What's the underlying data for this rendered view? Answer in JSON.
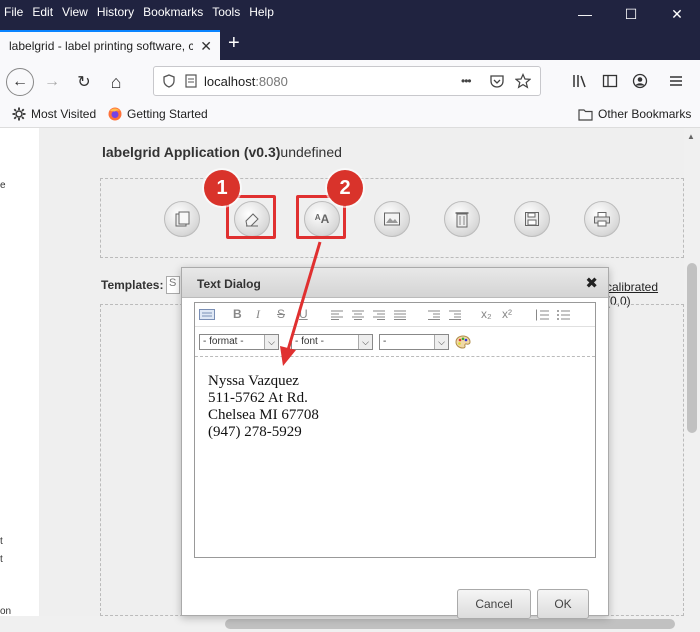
{
  "menu": [
    "File",
    "Edit",
    "View",
    "History",
    "Bookmarks",
    "Tools",
    "Help"
  ],
  "window": {
    "minimize": "—",
    "maximize": "☐",
    "close": "✕"
  },
  "tab": {
    "title": "labelgrid - label printing software, c",
    "close": "✕",
    "new": "+"
  },
  "nav": {
    "back": "←",
    "forward": "→",
    "reload": "↻",
    "home": "⌂",
    "url_host": "localhost",
    "url_port": ":8080",
    "more": "•••"
  },
  "bookmarks": {
    "most_visited": "Most Visited",
    "getting_started": "Getting Started",
    "other": "Other Bookmarks"
  },
  "left_fragments": [
    "e",
    "t",
    "t",
    "on"
  ],
  "app": {
    "title": "labelgrid Application (v0.3)",
    "suffix": "undefined"
  },
  "toolbar_icons": [
    "templates-icon",
    "eraser-icon",
    "text-icon",
    "image-icon",
    "trash-icon",
    "save-icon",
    "print-icon"
  ],
  "badges": [
    "1",
    "2"
  ],
  "templates_label": "Templates:",
  "templates_value": "S",
  "calibration": {
    "link": "calibrated",
    "coords": "(0,0)"
  },
  "dialog": {
    "title": "Text Dialog",
    "close": "✖",
    "toolbar": [
      "B",
      "I",
      "S",
      "U",
      "x₂",
      "x²"
    ],
    "format_select": "- format -",
    "font_select": "- font -",
    "size_select": "-",
    "text_lines": [
      "Nyssa Vazquez",
      "511-5762 At Rd.",
      "Chelsea MI 67708",
      "(947) 278-5929"
    ],
    "cancel": "Cancel",
    "ok": "OK"
  },
  "colors": {
    "titlebar": "#202340",
    "highlight": "#e03030",
    "badge": "#d9332b",
    "accent": "#0a84ff"
  }
}
